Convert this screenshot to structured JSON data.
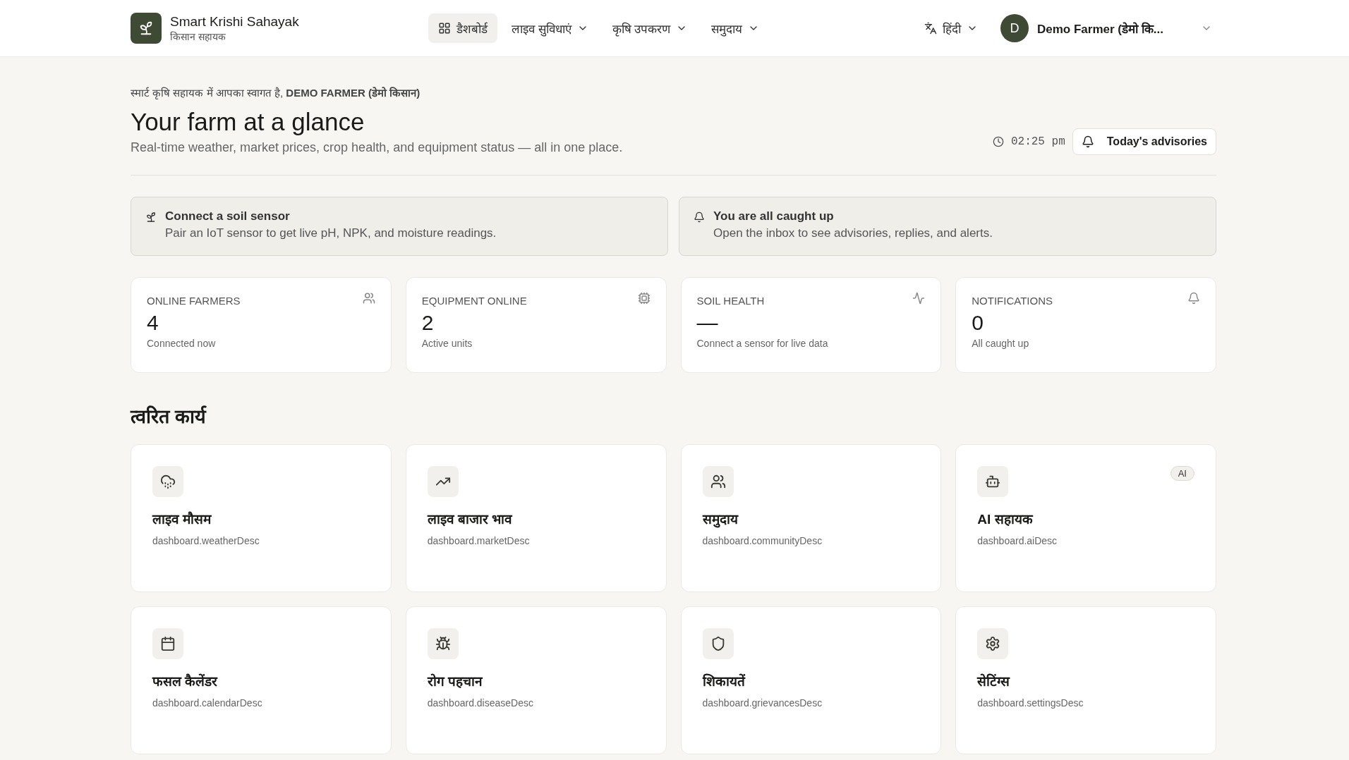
{
  "brand": {
    "title": "Smart Krishi Sahayak",
    "subtitle": "किसान सहायक"
  },
  "nav": [
    {
      "label": "डैशबोर्ड",
      "selected": true,
      "dropdown": false
    },
    {
      "label": "लाइव सुविधाएं",
      "selected": false,
      "dropdown": true
    },
    {
      "label": "कृषि उपकरण",
      "selected": false,
      "dropdown": true
    },
    {
      "label": "समुदाय",
      "selected": false,
      "dropdown": true
    }
  ],
  "language": "हिंदी",
  "user": {
    "initial": "D",
    "name": "Demo Farmer (डेमो कि..."
  },
  "welcome": {
    "prefix": "स्मार्ट कृषि सहायक में आपका स्वागत है, ",
    "name": "DEMO FARMER (डेमो किसान)"
  },
  "title": "Your farm at a glance",
  "subtitle": "Real-time weather, market prices, crop health, and equipment status — all in one place.",
  "time": "02:25 pm",
  "advisories_button": "Today's advisories",
  "banners": [
    {
      "title": "Connect a soil sensor",
      "text": "Pair an IoT sensor to get live pH, NPK, and moisture readings."
    },
    {
      "title": "You are all caught up",
      "text": "Open the inbox to see advisories, replies, and alerts."
    }
  ],
  "stats": [
    {
      "label": "ONLINE FARMERS",
      "value": "4",
      "note": "Connected now"
    },
    {
      "label": "EQUIPMENT ONLINE",
      "value": "2",
      "note": "Active units"
    },
    {
      "label": "SOIL HEALTH",
      "value": "—",
      "note": "Connect a sensor for live data"
    },
    {
      "label": "NOTIFICATIONS",
      "value": "0",
      "note": "All caught up"
    }
  ],
  "quick_title": "त्वरित कार्य",
  "quick_actions": [
    {
      "title": "लाइव मौसम",
      "desc": "dashboard.weatherDesc"
    },
    {
      "title": "लाइव बाजार भाव",
      "desc": "dashboard.marketDesc"
    },
    {
      "title": "समुदाय",
      "desc": "dashboard.communityDesc"
    },
    {
      "title": "AI सहायक",
      "desc": "dashboard.aiDesc",
      "badge": "AI"
    },
    {
      "title": "फसल कैलेंडर",
      "desc": "dashboard.calendarDesc"
    },
    {
      "title": "रोग पहचान",
      "desc": "dashboard.diseaseDesc"
    },
    {
      "title": "शिकायतें",
      "desc": "dashboard.grievancesDesc"
    },
    {
      "title": "सेटिंग्स",
      "desc": "dashboard.settingsDesc"
    }
  ]
}
